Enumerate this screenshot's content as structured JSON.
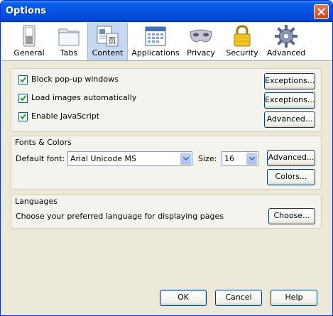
{
  "window": {
    "title": "Options"
  },
  "toolbar": {
    "panes": [
      {
        "label": "General",
        "icon": "general-switch-icon"
      },
      {
        "label": "Tabs",
        "icon": "tabs-folder-icon"
      },
      {
        "label": "Content",
        "icon": "content-page-icon",
        "selected": true
      },
      {
        "label": "Applications",
        "icon": "applications-calendar-icon"
      },
      {
        "label": "Privacy",
        "icon": "privacy-mask-icon"
      },
      {
        "label": "Security",
        "icon": "security-padlock-icon"
      },
      {
        "label": "Advanced",
        "icon": "advanced-gear-icon"
      }
    ]
  },
  "content": {
    "block_popups": {
      "label": "Block pop-up windows",
      "checked": true,
      "button": "Exceptions..."
    },
    "load_images": {
      "label": "Load images automatically",
      "checked": true,
      "button": "Exceptions..."
    },
    "javascript": {
      "label": "Enable JavaScript",
      "checked": true,
      "button": "Advanced..."
    }
  },
  "fonts": {
    "title": "Fonts & Colors",
    "default_font_label": "Default font:",
    "default_font_value": "Arial Unicode MS",
    "size_label": "Size:",
    "size_value": "16",
    "advanced_button": "Advanced...",
    "colors_button": "Colors..."
  },
  "languages": {
    "title": "Languages",
    "description": "Choose your preferred language for displaying pages",
    "choose_button": "Choose..."
  },
  "footer": {
    "ok": "OK",
    "cancel": "Cancel",
    "help": "Help"
  },
  "colors": {
    "titlebar": "#0554e3",
    "selected_pane": "#c5d7f1",
    "dialog_bg": "#ece9d8"
  }
}
